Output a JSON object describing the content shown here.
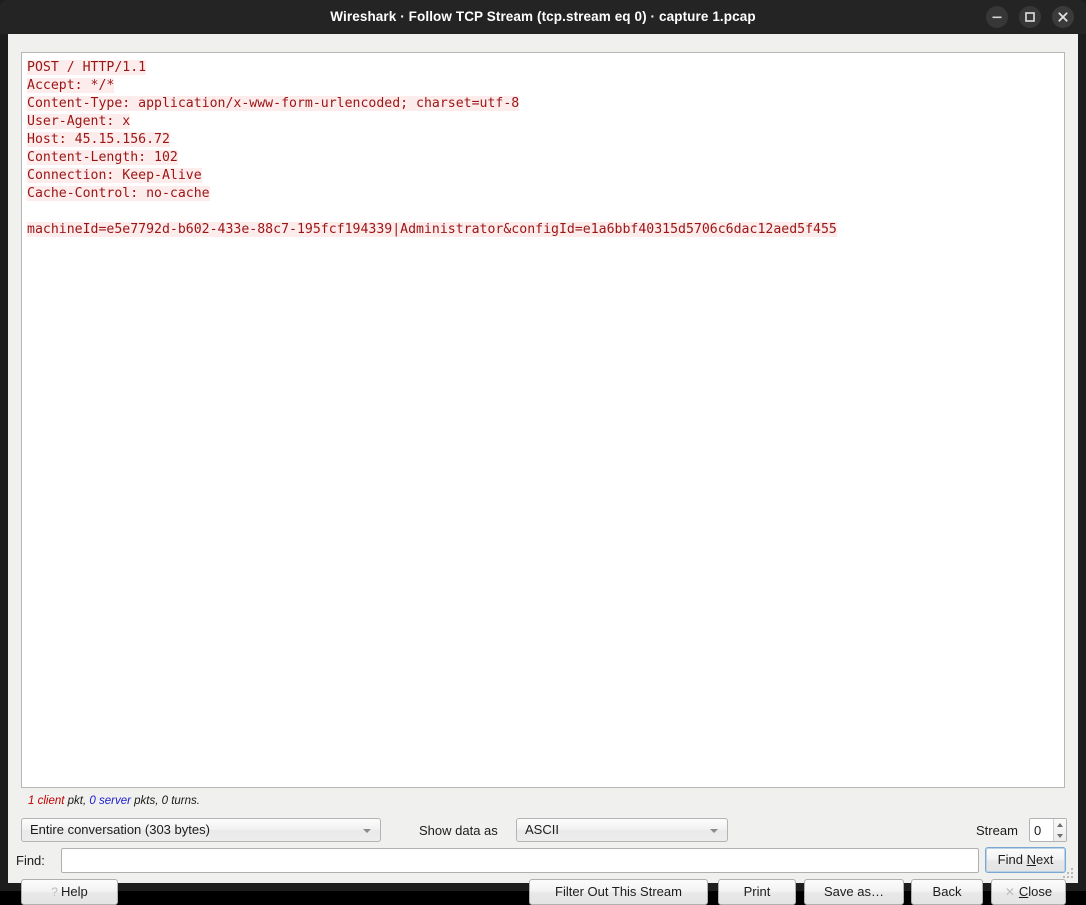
{
  "window": {
    "title": "Wireshark · Follow TCP Stream (tcp.stream eq 0) · capture 1.pcap",
    "controls": {
      "minimize": "minimize",
      "maximize": "maximize",
      "close": "close"
    }
  },
  "stream": {
    "lines": [
      "POST / HTTP/1.1",
      "Accept: */*",
      "Content-Type: application/x-www-form-urlencoded; charset=utf-8",
      "User-Agent: x",
      "Host: 45.15.156.72",
      "Content-Length: 102",
      "Connection: Keep-Alive",
      "Cache-Control: no-cache",
      "",
      "machineId=e5e7792d-b602-433e-88c7-195fcf194339|Administrator&configId=e1a6bbf40315d5706c6dac12aed5f455"
    ],
    "text_color": "#9c1515",
    "highlight_color": "#fdecec"
  },
  "status": {
    "client_count": "1 client",
    "client_suffix": " pkt, ",
    "server_count": "0 server",
    "server_suffix": " pkts, 0 turns.",
    "full": "1 client pkt, 0 server pkts, 0 turns.",
    "client_color": "#c00000",
    "server_color": "#1a1ad0"
  },
  "controls": {
    "conversation_select": "Entire conversation (303 bytes)",
    "show_data_as_label": "Show data as",
    "show_data_as_select": "ASCII",
    "stream_label": "Stream",
    "stream_value": "0",
    "find_label": "Find:",
    "find_value": "",
    "find_placeholder": "",
    "find_next_pre": "Find ",
    "find_next_mnemonic": "N",
    "find_next_post": "ext"
  },
  "buttons": {
    "help": "Help",
    "filter_out": "Filter Out This Stream",
    "print": "Print",
    "save_as": "Save as…",
    "back": "Back",
    "close_mnemonic": "C",
    "close_post": "lose"
  }
}
